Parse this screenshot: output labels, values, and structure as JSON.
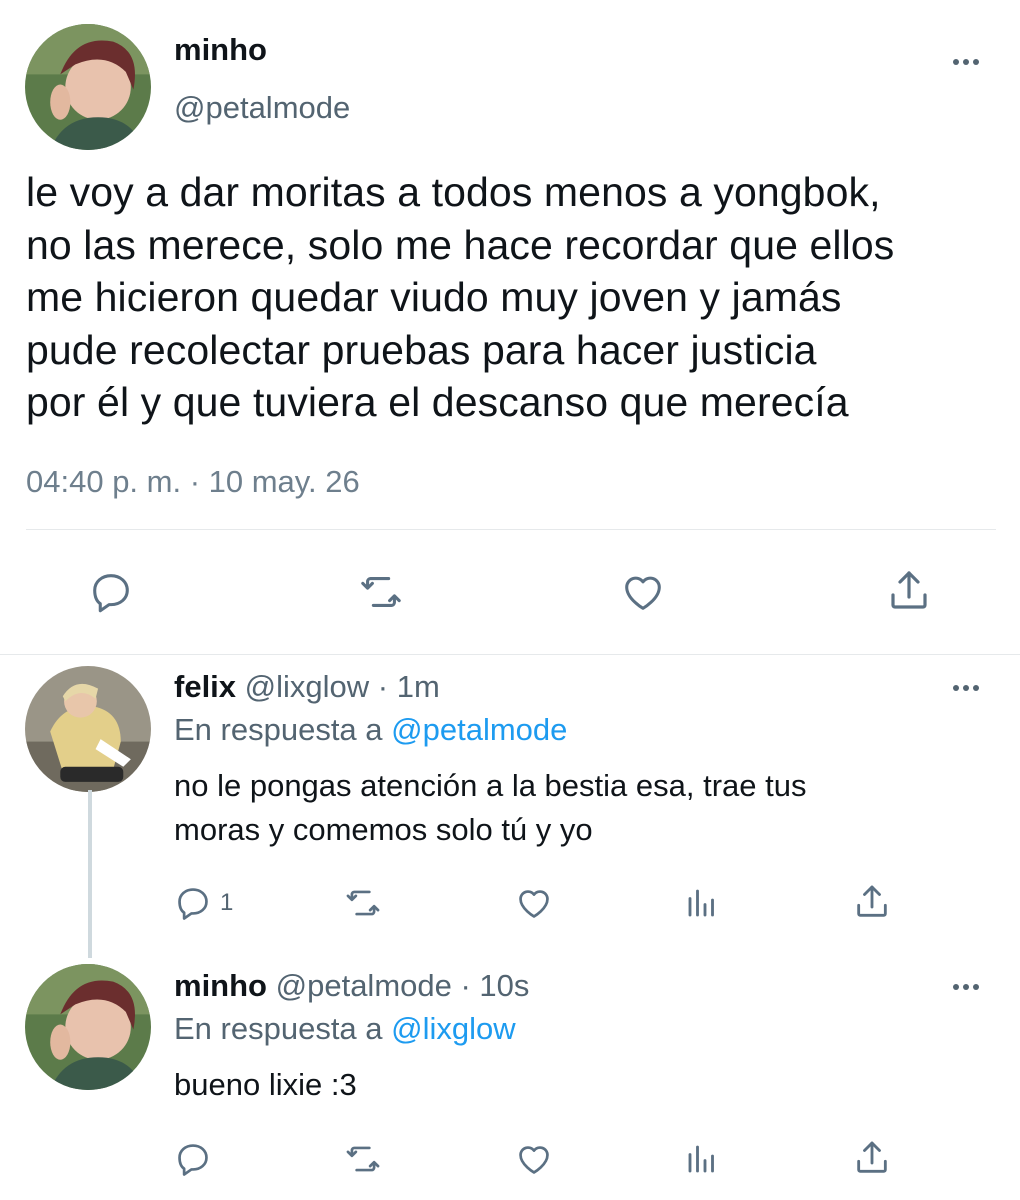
{
  "main_tweet": {
    "name": "minho",
    "handle": "@petalmode",
    "text_lines": [
      "le voy a dar moritas a todos menos a yongbok,",
      "no las merece, solo me hace recordar que ellos",
      "me hicieron quedar viudo muy joven y jamás",
      "pude recolectar pruebas para hacer justicia",
      "por él y que tuviera el descanso que merecía"
    ],
    "timestamp": "04:40 p. m. · 10 may. 26",
    "actions": [
      "reply-icon",
      "retweet-icon",
      "like-icon",
      "share-icon"
    ]
  },
  "replies": [
    {
      "name": "felix",
      "handle": "@lixglow",
      "time": "· 1m",
      "replying_prefix": "En respuesta a",
      "replying_to": "@petalmode",
      "text_lines": [
        "no le pongas atención a la bestia esa, trae tus",
        "moras y comemos solo tú y yo"
      ],
      "reply_count": "1"
    },
    {
      "name": "minho",
      "handle": "@petalmode",
      "time": "· 10s",
      "replying_prefix": "En respuesta a",
      "replying_to": "@lixglow",
      "text_lines": [
        "bueno lixie :3"
      ]
    }
  ],
  "colors": {
    "text": "#0f1419",
    "secondary": "#536471",
    "link": "#1d9bf0",
    "divider": "#e6e9eb",
    "icon_main": "#5b7083"
  }
}
